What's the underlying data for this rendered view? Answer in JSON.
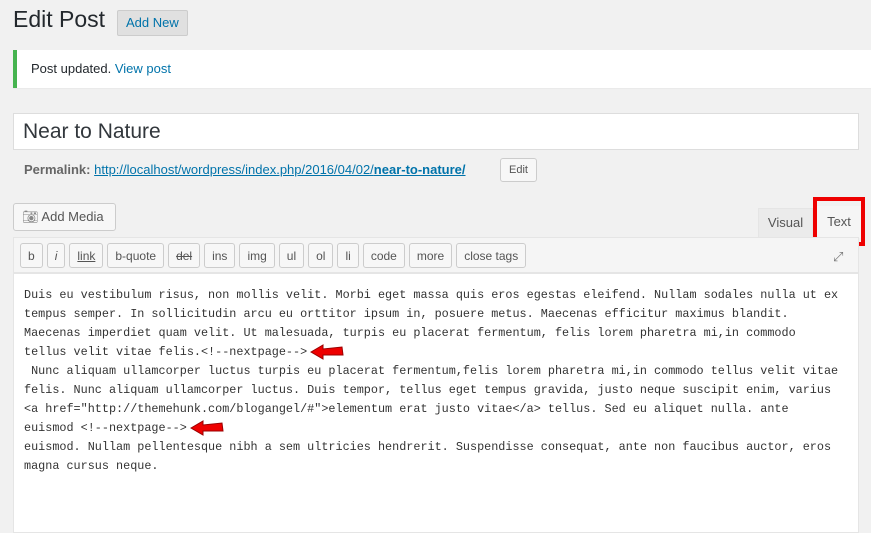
{
  "header": {
    "title": "Edit Post",
    "add_new": "Add New"
  },
  "notice": {
    "text": "Post updated.",
    "link": "View post"
  },
  "post": {
    "title": "Near to Nature",
    "permalink_label": "Permalink:",
    "permalink_base": "http://localhost/wordpress/index.php/2016/04/02/",
    "permalink_slug": "near-to-nature/",
    "permalink_edit": "Edit"
  },
  "editor": {
    "add_media": "Add Media",
    "tabs": {
      "visual": "Visual",
      "text": "Text"
    },
    "active_tab": "Text",
    "highlight_color": "#e00000",
    "quicktags": [
      "b",
      "i",
      "link",
      "b-quote",
      "del",
      "ins",
      "img",
      "ul",
      "ol",
      "li",
      "code",
      "more",
      "close tags"
    ],
    "lines": [
      "Duis eu vestibulum risus, non mollis velit. Morbi eget massa quis eros egestas eleifend. Nullam sodales nulla ut ex",
      "tempus semper. In sollicitudin arcu eu orttitor ipsum in, posuere metus. Maecenas efficitur maximus blandit.",
      "Maecenas imperdiet quam velit. Ut malesuada, turpis eu placerat fermentum, felis lorem pharetra mi,in commodo",
      "tellus velit vitae felis.<!--nextpage-->",
      " Nunc aliquam ullamcorper luctus turpis eu placerat fermentum,felis lorem pharetra mi,in commodo tellus velit vitae",
      "felis. Nunc aliquam ullamcorper luctus. Duis tempor, tellus eget tempus gravida, justo neque suscipit enim, varius",
      "<a href=\"http://themehunk.com/blogangel/#\">elementum erat justo vitae</a> tellus. Sed eu aliquet nulla. ante",
      "euismod <!--nextpage-->",
      "euismod. Nullam pellentesque nibh a sem ultricies hendrerit. Suspendisse consequat, ante non faucibus auctor, eros",
      "magna cursus neque."
    ]
  }
}
